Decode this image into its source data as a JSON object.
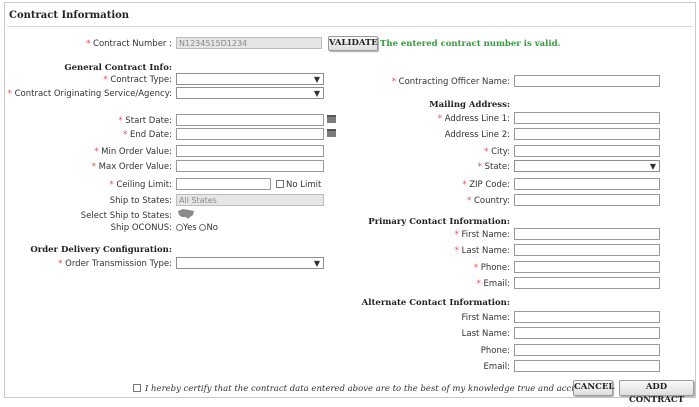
{
  "title": "Contract Information",
  "contract_number": {
    "label": "Contract Number :",
    "value": "N1234515D1234",
    "validate_label": "VALIDATE",
    "valid_message": "The entered contract number is valid."
  },
  "general": {
    "heading": "General Contract Info:",
    "contract_type_label": "Contract Type:",
    "originating_label": "Contract Originating Service/Agency:",
    "start_label": "Start Date:",
    "end_label": "End Date:",
    "min_order_label": "Min Order Value:",
    "max_order_label": "Max Order Value:",
    "ceiling_label": "Ceiling Limit:",
    "no_limit_label": "No Limit",
    "ship_to_label": "Ship to States:",
    "ship_to_value": "All States",
    "select_ship_label": "Select Ship to States:",
    "oconus_label": "Ship OCONUS:",
    "oconus_yes": "Yes",
    "oconus_no": "No"
  },
  "delivery": {
    "heading": "Order Delivery Configuration:",
    "transmission_label": "Order Transmission Type:"
  },
  "officer": {
    "label": "Contracting Officer Name:"
  },
  "mailing": {
    "heading": "Mailing Address:",
    "addr1": "Address Line 1:",
    "addr2": "Address Line 2:",
    "city": "City:",
    "state": "State:",
    "zip": "ZIP Code:",
    "country": "Country:"
  },
  "primary": {
    "heading": "Primary Contact Information:",
    "first": "First Name:",
    "last": "Last Name:",
    "phone": "Phone:",
    "email": "Email:"
  },
  "alternate": {
    "heading": "Alternate Contact Information:",
    "first": "First Name:",
    "last": "Last Name:",
    "phone": "Phone:",
    "email": "Email:"
  },
  "footer": {
    "certify": "I hereby certify that the contract data entered above are to the best of my knowledge true and accurate.",
    "cancel": "CANCEL",
    "add": "ADD CONTRACT"
  },
  "icons": {
    "calendar": "calendar-icon",
    "map": "us-map-icon",
    "dropdown": "chevron-down-icon"
  },
  "colors": {
    "required": "#ee4444",
    "valid": "#2f9e3a"
  }
}
